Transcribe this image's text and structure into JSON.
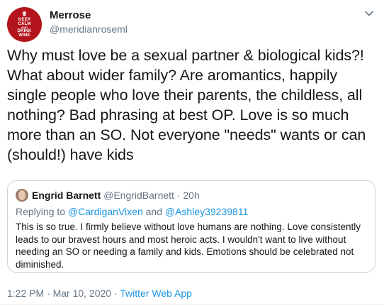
{
  "tweet": {
    "avatar_text": [
      "KEEP",
      "CALM",
      "AND",
      "DRINK",
      "WINE"
    ],
    "display_name": "Merrose",
    "handle": "@meridianroseml",
    "body_lines": [
      "Why must love be a sexual partner & biological kids?!",
      "What about wider family? Are aromantics, happily",
      "single people who love their parents, the childless, all",
      "nothing? Bad phrasing at best OP. Love is so much",
      "more than an SO. Not everyone \"needs\" wants or can",
      "(should!) have kids"
    ],
    "timestamp": "1:22 PM · Mar 10, 2020 · ",
    "source": "Twitter Web App"
  },
  "quote": {
    "display_name": "Engrid Barnett",
    "meta": " @EngridBarnett · 20h",
    "replying_prefix": "Replying to ",
    "reply_user_1": "@CardiganVixen",
    "reply_and": " and ",
    "reply_user_2": "@Ashley39239811",
    "text_lines": [
      "This is so true. I firmly believe without love humans are nothing. Love consistently",
      "leads to our bravest hours and most heroic acts. I wouldn't want to live without",
      "needing an SO or needing a family and kids. Emotions should be celebrated not",
      "diminished."
    ]
  },
  "colors": {
    "link": "#1b95e0",
    "secondary_text": "#657786",
    "border": "#ccd6dd",
    "avatar_bg": "#b3141c"
  },
  "icons": {
    "caret": "chevron-down-icon",
    "crown": "crown-icon"
  }
}
